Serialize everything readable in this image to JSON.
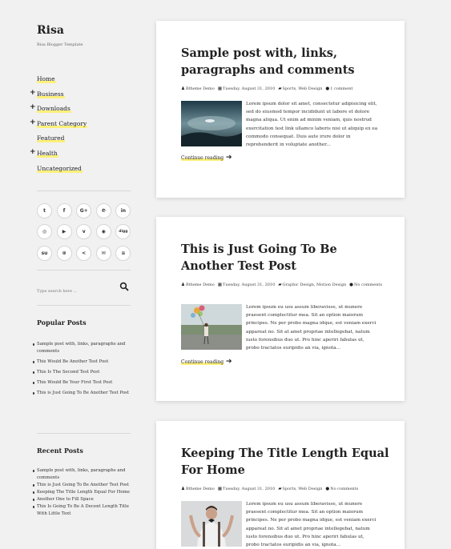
{
  "site": {
    "title": "Risa",
    "tagline": "Risa Blogger Template"
  },
  "menu": [
    {
      "label": "Home",
      "has_children": false
    },
    {
      "label": "Business",
      "has_children": true
    },
    {
      "label": "Downloads",
      "has_children": true
    },
    {
      "label": "Parent Category",
      "has_children": true
    },
    {
      "label": "Featured",
      "has_children": false
    },
    {
      "label": "Health",
      "has_children": true
    },
    {
      "label": "Uncategorized",
      "has_children": false
    }
  ],
  "social": [
    {
      "icon": "twitter-icon",
      "glyph": "t"
    },
    {
      "icon": "facebook-icon",
      "glyph": "f"
    },
    {
      "icon": "google-plus-icon",
      "glyph": "G+"
    },
    {
      "icon": "pinterest-icon",
      "glyph": "℗"
    },
    {
      "icon": "linkedin-icon",
      "glyph": "in"
    },
    {
      "icon": "instagram-icon",
      "glyph": "◎"
    },
    {
      "icon": "youtube-icon",
      "glyph": "▶"
    },
    {
      "icon": "vimeo-icon",
      "glyph": "v"
    },
    {
      "icon": "github-icon",
      "glyph": "◉"
    },
    {
      "icon": "digg-icon",
      "glyph": "digg"
    },
    {
      "icon": "stumbleupon-icon",
      "glyph": "su"
    },
    {
      "icon": "dribbble-icon",
      "glyph": "⊛"
    },
    {
      "icon": "share-icon",
      "glyph": "<"
    },
    {
      "icon": "email-icon",
      "glyph": "✉"
    },
    {
      "icon": "rss-icon",
      "glyph": "≋"
    }
  ],
  "search": {
    "placeholder": "Type search here ..."
  },
  "popular": {
    "title": "Popular Posts",
    "items": [
      "Sample post with, links, paragraphs and comments",
      "This Would Be Another Test Post",
      "This Is The Second Test Post",
      "This Would Be Your First Test Post",
      "This is Just Going To Be Another Test Post"
    ]
  },
  "recent": {
    "title": "Recent Posts",
    "items": [
      "Sample post with, links, paragraphs and comments",
      "This is Just Going To Be Another Test Post",
      "Keeping The Title Length Equal For Home",
      "Another One to Fill Space",
      "This Is Going To Be A Decent Length Title With Little Text"
    ]
  },
  "posts": [
    {
      "title": "Sample post with, links, paragraphs and comments",
      "author": "Btheme Demo",
      "date": "Tuesday, August 31, 2010",
      "categories": "Sports, Web Design",
      "comments": "1 comment",
      "excerpt": "Lorem ipsum dolor sit amet, consectetur adipisicing elit, sed do eiusmod tempor incididunt ut labore et dolore magna aliqua. Ut enim ad minim veniam, quis nostrud exercitation test link ullamco laboris nisi ut aliquip ex ea commodo consequat. Duis aute irure dolor in reprehenderit in voluptate another...",
      "continue": "Continue reading"
    },
    {
      "title": "This is Just Going To Be Another Test Post",
      "author": "Btheme Demo",
      "date": "Tuesday, August 31, 2010",
      "categories": "Graphic Design, Motion Design",
      "comments": "No comments",
      "excerpt": "Lorem ipsum eu usu assum liberavisse, ut munere praesent complectitur mea. Sit an option maiorum principes. Ne per probo magna idque, est veniam exerci appareat no. Sit at amet propriae intellegebat, natum iusto forensibus duo ut. Pro hinc aperiri fabulas ut, probo tractatos euripidis an via, ignota...",
      "continue": "Continue reading"
    },
    {
      "title": "Keeping The Title Length Equal For Home",
      "author": "Btheme Demo",
      "date": "Tuesday, August 31, 2010",
      "categories": "Sports, Web Design",
      "comments": "No comments",
      "excerpt": "Lorem ipsum eu usu assum liberavisse, ut munere praesent complectitur mea. Sit an option maiorum principes. Ne per probo magna idque, est veniam exerci appareat no. Sit at amet propriae intellegebat, natum iusto forensibus duo ut. Pro hinc aperiri fabulas ut, probo tractatos euripidis an via, ignota..."
    }
  ]
}
